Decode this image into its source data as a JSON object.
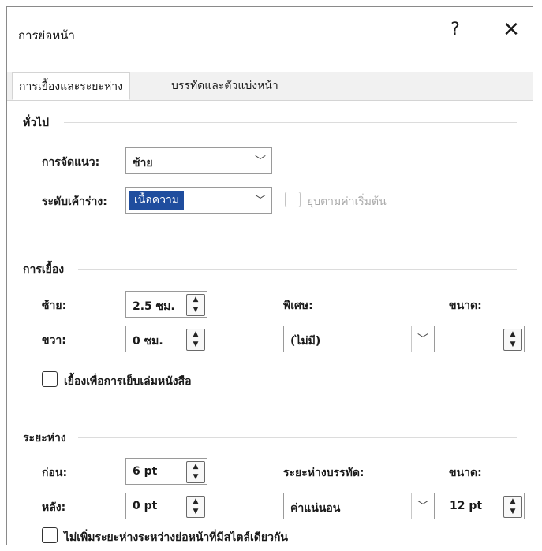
{
  "window": {
    "title": "การย่อหน้า",
    "help_label": "?",
    "close_label": "✕"
  },
  "tabs": [
    {
      "label": "การเยื้องและระยะห่าง",
      "active": true
    },
    {
      "label": "บรรทัดและตัวแบ่งหน้า",
      "active": false
    }
  ],
  "general": {
    "title": "ทั่วไป",
    "alignment_label": "การจัดแนว:",
    "alignment_value": "ซ้าย",
    "outline_label": "ระดับเค้าร่าง:",
    "outline_value": "เนื้อความ",
    "collapsed_label": "ยุบตามค่าเริ่มต้น"
  },
  "indentation": {
    "title": "การเยื้อง",
    "left_label": "ซ้าย:",
    "left_value": "2.5 ซม.",
    "right_label": "ขวา:",
    "right_value": "0 ซม.",
    "special_label": "พิเศษ:",
    "special_value": "(ไม่มี)",
    "by_label": "ขนาด:",
    "by_value": "",
    "mirror_label": "เยื้องเพื่อการเย็บเล่มหนังสือ"
  },
  "spacing": {
    "title": "ระยะห่าง",
    "before_label": "ก่อน:",
    "before_value": "6 pt",
    "after_label": "หลัง:",
    "after_value": "0 pt",
    "line_spacing_label": "ระยะห่างบรรทัด:",
    "line_spacing_value": "ค่าแน่นอน",
    "at_label": "ขนาด:",
    "at_value": "12 pt",
    "dont_add_label": "ไม่เพิ่มระยะห่างระหว่างย่อหน้าที่มีสไตล์เดียวกัน"
  },
  "icons": {
    "chevron": "chevron-down-icon",
    "spin": "spin-arrows-icon",
    "up_glyph": "▲",
    "down_glyph": "▼",
    "chevron_glyph": "﹀"
  },
  "colors": {
    "highlight": "#1f4d9e",
    "border": "#9a9a9a"
  }
}
